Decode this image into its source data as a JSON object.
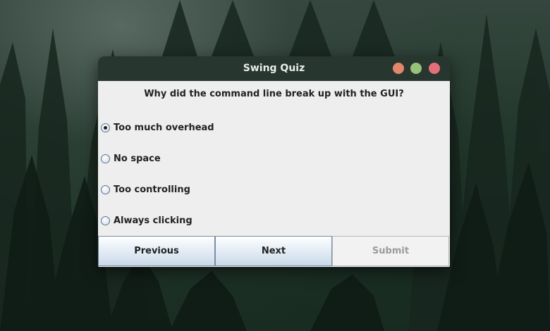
{
  "window": {
    "title": "Swing Quiz",
    "controls": {
      "minimize_color": "#e0876c",
      "maximize_color": "#98c27a",
      "close_color": "#e46f79"
    }
  },
  "quiz": {
    "question": "Why did the command line break up with the GUI?",
    "options": [
      {
        "label": "Too much overhead",
        "selected": true
      },
      {
        "label": "No space",
        "selected": false
      },
      {
        "label": "Too controlling",
        "selected": false
      },
      {
        "label": "Always clicking",
        "selected": false
      }
    ]
  },
  "buttons": {
    "previous": "Previous",
    "next": "Next",
    "submit": "Submit",
    "submit_enabled": false
  }
}
